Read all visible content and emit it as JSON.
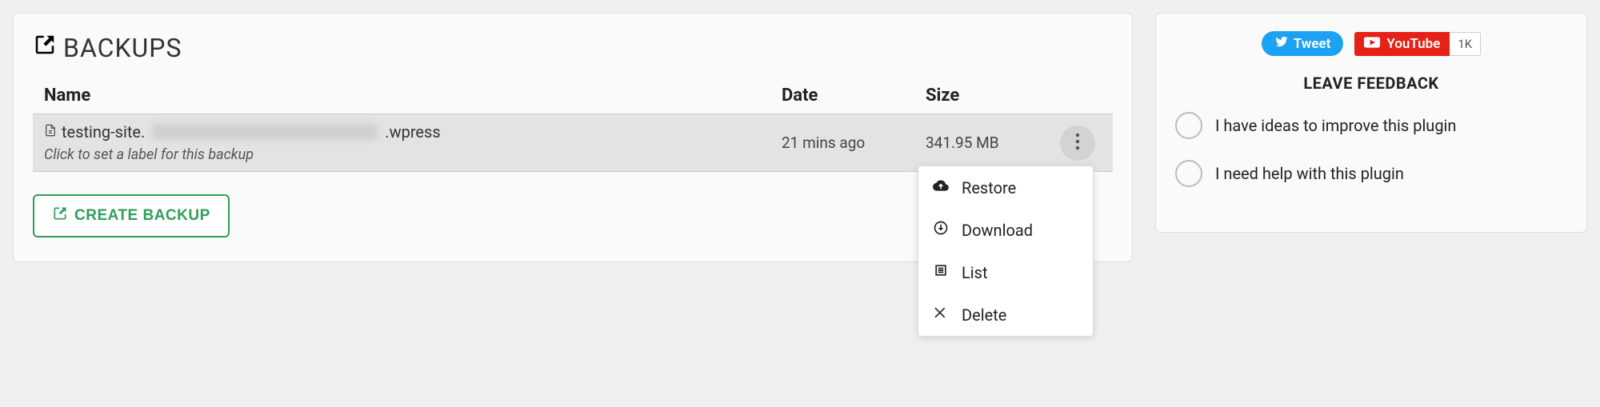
{
  "panel": {
    "title": "BACKUPS",
    "table": {
      "headers": {
        "name": "Name",
        "date": "Date",
        "size": "Size"
      },
      "rows": [
        {
          "file_prefix": "testing-site.",
          "file_suffix": ".wpress",
          "label_hint": "Click to set a label for this backup",
          "date": "21 mins ago",
          "size": "341.95 MB"
        }
      ]
    },
    "dropdown": {
      "restore": "Restore",
      "download": "Download",
      "list": "List",
      "delete": "Delete"
    },
    "create_button": "CREATE BACKUP"
  },
  "sidebar": {
    "tweet_label": "Tweet",
    "youtube_label": "YouTube",
    "youtube_count": "1K",
    "feedback_title": "LEAVE FEEDBACK",
    "options": [
      "I have ideas to improve this plugin",
      "I need help with this plugin"
    ]
  }
}
